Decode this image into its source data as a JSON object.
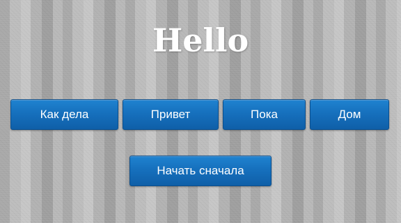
{
  "page": {
    "title": "Hello"
  },
  "buttons": {
    "row1": [
      "Как дела",
      "Привет",
      "Пока",
      "Дом"
    ],
    "restart": "Начать сначала"
  },
  "colors": {
    "button_top": "#1f82d0",
    "button_bottom": "#0f5fa8",
    "button_text": "#ffffff",
    "title_text": "#ffffff"
  }
}
